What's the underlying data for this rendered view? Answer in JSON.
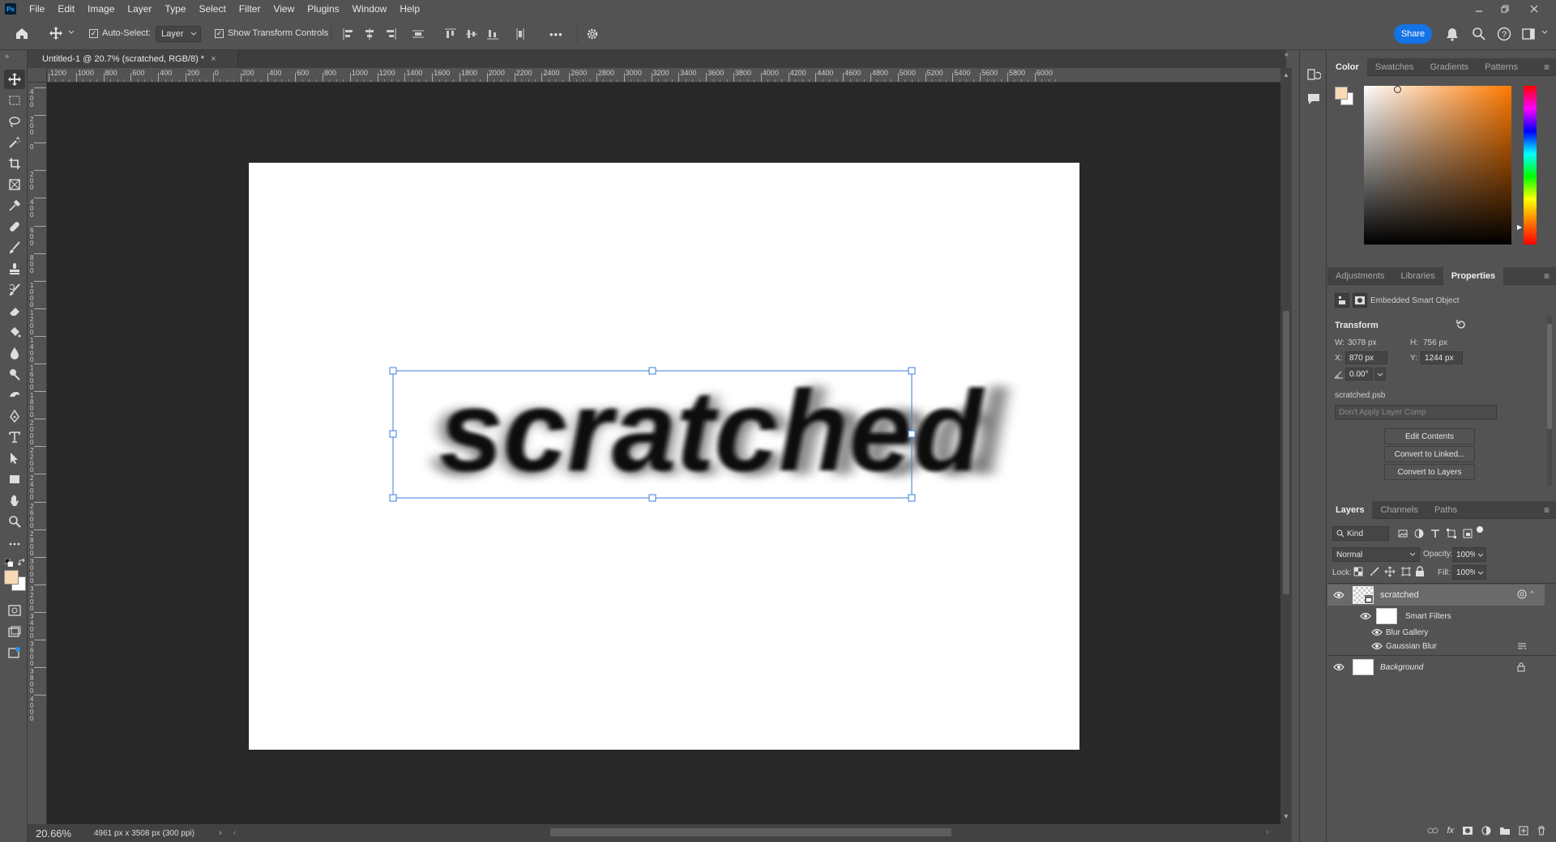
{
  "app": {
    "logo_text": "Ps",
    "menu": [
      "File",
      "Edit",
      "Image",
      "Layer",
      "Type",
      "Select",
      "Filter",
      "View",
      "Plugins",
      "Window",
      "Help"
    ]
  },
  "options": {
    "auto_select_label": "Auto-Select:",
    "auto_select_target": "Layer",
    "show_transform_label": "Show Transform Controls",
    "more_label": "•••",
    "share_label": "Share"
  },
  "document": {
    "tab_title": "Untitled-1 @ 20.7% (scratched, RGB/8) *",
    "tab_close": "×",
    "canvas_text": "scratched",
    "zoom": "20.66%",
    "dimensions": "4961 px x 3508 px (300 ppi)",
    "ruler_top_labels": [
      "1200",
      "1000",
      "800",
      "600",
      "400",
      "200",
      "0",
      "200",
      "400",
      "600",
      "800",
      "1000",
      "1200",
      "1400",
      "1600",
      "1800",
      "2000",
      "2200",
      "2400",
      "2600",
      "2800",
      "3000",
      "3200",
      "3400",
      "3600",
      "3800",
      "4000",
      "4200",
      "4400",
      "4600",
      "4800",
      "5000",
      "5200",
      "5400",
      "5600",
      "5800",
      "6000"
    ],
    "ruler_left_labels": [
      "400",
      "200",
      "0",
      "200",
      "400",
      "600",
      "800",
      "1000",
      "1200",
      "1400",
      "1600",
      "1800",
      "2000",
      "2200",
      "2400",
      "2600",
      "2800",
      "3000",
      "3200",
      "3400",
      "3600",
      "3800",
      "4000"
    ]
  },
  "color_panel": {
    "tabs": [
      "Color",
      "Swatches",
      "Gradients",
      "Patterns"
    ],
    "active_tab": "Color",
    "foreground": "#f9d8b4",
    "background": "#ffffff",
    "hue_base": "#ff7a00"
  },
  "properties_panel": {
    "tabs": [
      "Adjustments",
      "Libraries",
      "Properties"
    ],
    "active_tab": "Properties",
    "object_type": "Embedded Smart Object",
    "section_title": "Transform",
    "w_label": "W:",
    "w_value": "3078 px",
    "h_label": "H:",
    "h_value": "756 px",
    "x_label": "X:",
    "x_value": "870 px",
    "y_label": "Y:",
    "y_value": "1244 px",
    "angle_value": "0.00°",
    "file_name": "scratched.psb",
    "layer_comp_placeholder": "Don't Apply Layer Comp",
    "buttons": [
      "Edit Contents",
      "Convert to Linked...",
      "Convert to Layers"
    ]
  },
  "layers_panel": {
    "tabs": [
      "Layers",
      "Channels",
      "Paths"
    ],
    "active_tab": "Layers",
    "filter_kind": "Kind",
    "blend_mode": "Normal",
    "opacity_label": "Opacity:",
    "opacity_value": "100%",
    "lock_label": "Lock:",
    "fill_label": "Fill:",
    "fill_value": "100%",
    "layers": {
      "scratched": "scratched",
      "smart_filters": "Smart Filters",
      "blur_gallery": "Blur Gallery",
      "gaussian_blur": "Gaussian Blur",
      "background": "Background"
    }
  }
}
